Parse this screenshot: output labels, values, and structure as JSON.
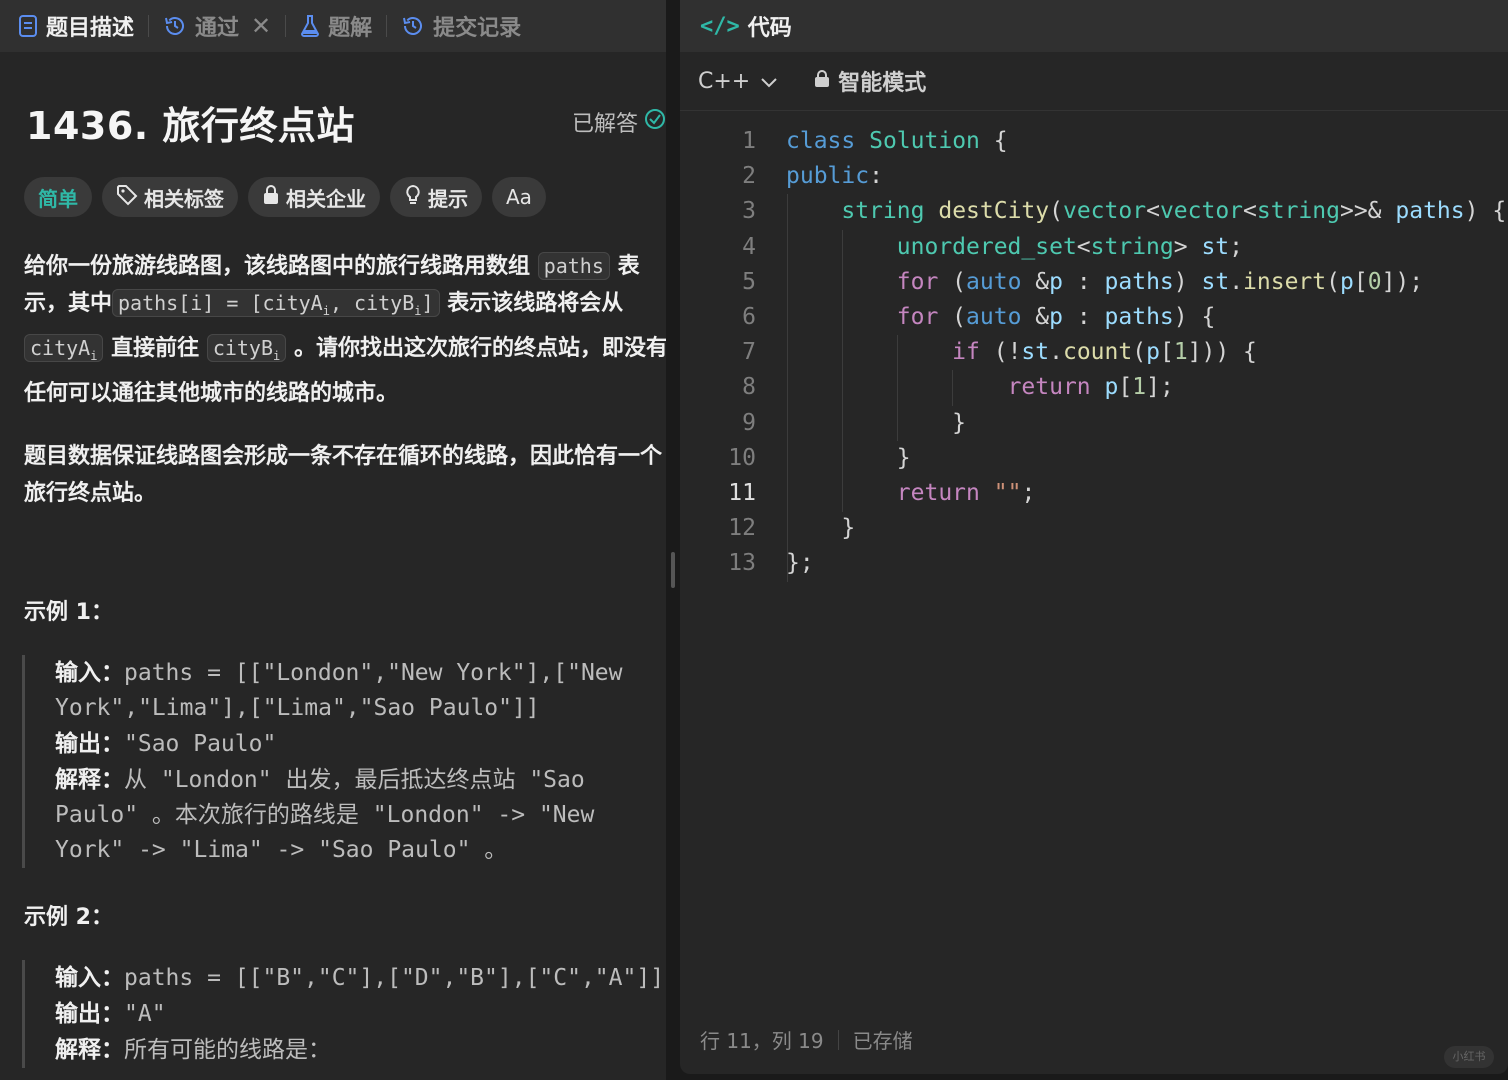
{
  "left_tabs": [
    {
      "label": "题目描述",
      "icon": "document-icon"
    },
    {
      "label": "通过",
      "icon": "history-icon"
    },
    {
      "label": "题解",
      "icon": "flask-icon"
    },
    {
      "label": "提交记录",
      "icon": "history-icon"
    }
  ],
  "problem": {
    "title": "1436. 旅行终点站",
    "solved_label": "已解答",
    "difficulty": "简单",
    "chips": [
      "相关标签",
      "相关企业",
      "提示",
      "Aa"
    ]
  },
  "description": {
    "p1": [
      "给你一份旅游线路图，该线路图中的旅行线路用数组",
      "paths",
      "表示，其中",
      "paths[i] = [cityA",
      "i",
      ", cityB",
      "i",
      "]",
      "表示该线路将会从",
      "cityA",
      "i",
      "直接前往",
      "cityB",
      "i",
      "。请你找出这次旅行的终点站，即没有任何可以通往其他城市的线路的城市。"
    ],
    "p2": "题目数据保证线路图会形成一条不存在循环的线路，因此恰有一个旅行终点站。"
  },
  "examples": [
    {
      "title": "示例 1：",
      "input_label": "输入：",
      "input": "paths = [[\"London\",\"New York\"],[\"New York\",\"Lima\"],[\"Lima\",\"Sao Paulo\"]]",
      "output_label": "输出：",
      "output": "\"Sao Paulo\"",
      "explain_label": "解释：",
      "explain": "从 \"London\" 出发，最后抵达终点站 \"Sao Paulo\" 。本次旅行的路线是 \"London\" -> \"New York\" -> \"Lima\" -> \"Sao Paulo\" 。"
    },
    {
      "title": "示例 2：",
      "input_label": "输入：",
      "input": "paths = [[\"B\",\"C\"],[\"D\",\"B\"],[\"C\",\"A\"]]",
      "output_label": "输出：",
      "output": "\"A\"",
      "explain_label": "解释：",
      "explain": "所有可能的线路是："
    }
  ],
  "editor": {
    "panel_title": "代码",
    "language": "C++",
    "mode": "智能模式",
    "current_line": 11,
    "lines": [
      "class Solution {",
      "public:",
      "    string destCity(vector<vector<string>>& paths) {",
      "        unordered_set<string> st;",
      "        for (auto &p : paths) st.insert(p[0]);",
      "        for (auto &p : paths) {",
      "            if (!st.count(p[1])) {",
      "                return p[1];",
      "            }",
      "        }",
      "        return \"\";",
      "    }",
      "};"
    ],
    "status_position": "行 11，列 19",
    "status_saved": "已存储",
    "watermark": "小红书"
  },
  "colors": {
    "accent_green": "#2fb8a7",
    "keyword_blue": "#569cd6",
    "type_teal": "#4ec9b0"
  }
}
